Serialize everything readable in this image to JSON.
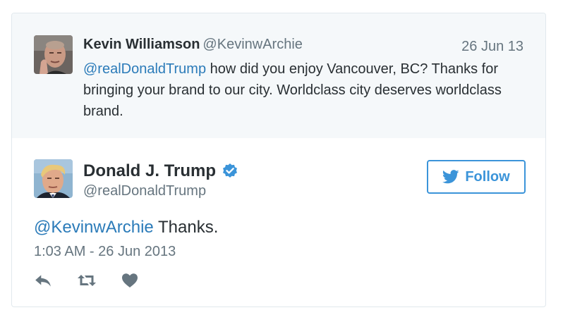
{
  "parent_tweet": {
    "name": "Kevin Williamson",
    "handle": "@KevinwArchie",
    "date": "26 Jun 13",
    "mention": "@realDonaldTrump",
    "text": " how did you enjoy Vancouver, BC? Thanks for bringing your brand to our city. Worldclass city deserves worldclass brand."
  },
  "tweet": {
    "name": "Donald J. Trump",
    "handle": "@realDonaldTrump",
    "follow_label": "Follow",
    "mention": "@KevinwArchie",
    "text": " Thanks.",
    "timestamp": "1:03 AM - 26 Jun 2013"
  },
  "icons": {
    "verified": "verified-badge-icon",
    "follow_bird": "twitter-bird-icon",
    "reply": "reply-icon",
    "retweet": "retweet-icon",
    "like": "heart-icon"
  },
  "colors": {
    "link": "#2b7bb9",
    "follow_accent": "#3b94d9",
    "action_gray": "#66757f",
    "parent_background": "#f5f8fa"
  }
}
